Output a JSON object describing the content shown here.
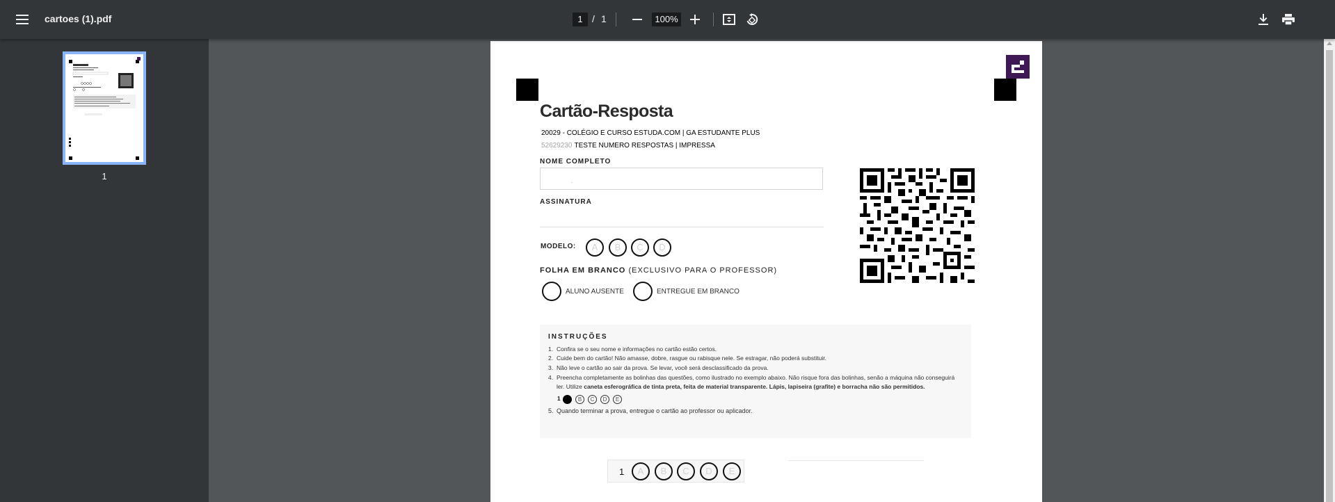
{
  "toolbar": {
    "title": "cartoes (1).pdf",
    "current_page": "1",
    "page_separator": "/",
    "total_pages": "1",
    "zoom": "100%",
    "icons": [
      "menu-icon",
      "zoom-out-icon",
      "zoom-in-icon",
      "fit-page-icon",
      "rotate-icon",
      "download-icon",
      "print-icon"
    ]
  },
  "sidebar": {
    "thumbnail_label": "1"
  },
  "card": {
    "title": "Cartão-Resposta",
    "school": "20029 - COLÉGIO E CURSO ESTUDA.COM | GA ESTUDANTE PLUS",
    "code": "52629230",
    "exam": "TESTE NUMERO RESPOSTAS | IMPRESSA",
    "name_label": "NOME COMPLETO",
    "name_mark": ".",
    "signature_label": "ASSINATURA",
    "model_label": "MODELO:",
    "model_options": [
      "A",
      "B",
      "C",
      "D"
    ],
    "blank_title_bold": "FOLHA EM BRANCO",
    "blank_title_rest": "(EXCLUSIVO PARA O PROFESSOR)",
    "absent_label": "ALUNO AUSENTE",
    "blank_label": "ENTREGUE EM BRANCO",
    "logo_color": "#3e1955"
  },
  "instructions": {
    "title": "INSTRUÇÕES",
    "items": [
      {
        "n": "1.",
        "text": "Confira se o seu nome e informações no cartão estão certos."
      },
      {
        "n": "2.",
        "text": "Cuide bem do cartão! Não amasse, dobre, rasgue ou rabisque nele. Se estragar, não poderá substituir."
      },
      {
        "n": "3.",
        "text": "Não leve o cartão ao sair da prova. Se levar, você será desclassificado da prova."
      },
      {
        "n": "4.",
        "text": "Preencha completamente as bolinhas das questões, como ilustrado no exemplo abaixo. Não risque fora das bolinhas, senão a máquina não conseguirá"
      }
    ],
    "item4_cont_prefix": "ler. Utilize",
    "item4_cont_bold": "caneta esferográfica de tinta preta, feita de material transparente. Lápis, lapiseira (grafite) e borracha não são permitidos.",
    "example_number": "1",
    "example_options": [
      "A",
      "B",
      "C",
      "D",
      "E"
    ],
    "item5_n": "5.",
    "item5_text": "Quando terminar a prova, entregue o cartão ao professor ou aplicador."
  },
  "answer": {
    "number": "1",
    "options": [
      "A",
      "B",
      "C",
      "D",
      "E"
    ]
  }
}
